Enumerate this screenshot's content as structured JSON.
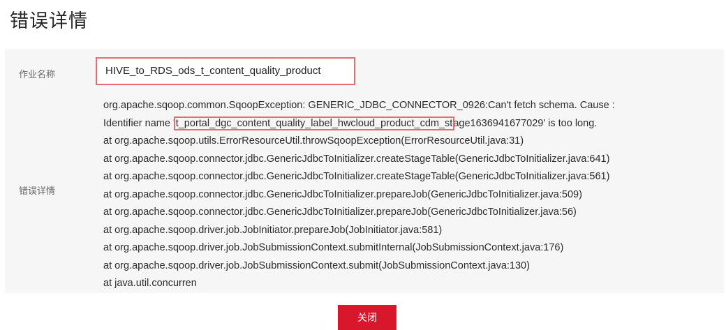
{
  "dialog": {
    "title": "错误详情",
    "close_label": "关闭"
  },
  "job": {
    "label": "作业名称",
    "name": "HIVE_to_RDS_ods_t_content_quality_product"
  },
  "error": {
    "label": "错误详情",
    "line1": "org.apache.sqoop.common.SqoopException: GENERIC_JDBC_CONNECTOR_0926:Can't fetch schema. Cause :",
    "line2_prefix": "Identifier name '",
    "line2_highlight": "t_portal_dgc_content_quality_label_hwcloud_product_cdm_st",
    "line2_suffix": "age1636941677029' is too long.",
    "stack": [
      "at org.apache.sqoop.utils.ErrorResourceUtil.throwSqoopException(ErrorResourceUtil.java:31)",
      "at org.apache.sqoop.connector.jdbc.GenericJdbcToInitializer.createStageTable(GenericJdbcToInitializer.java:641)",
      "at org.apache.sqoop.connector.jdbc.GenericJdbcToInitializer.createStageTable(GenericJdbcToInitializer.java:561)",
      "at org.apache.sqoop.connector.jdbc.GenericJdbcToInitializer.prepareJob(GenericJdbcToInitializer.java:509)",
      "at org.apache.sqoop.connector.jdbc.GenericJdbcToInitializer.prepareJob(GenericJdbcToInitializer.java:56)",
      "at org.apache.sqoop.driver.job.JobInitiator.prepareJob(JobInitiator.java:581)",
      "at org.apache.sqoop.driver.job.JobSubmissionContext.submitInternal(JobSubmissionContext.java:176)",
      "at org.apache.sqoop.driver.job.JobSubmissionContext.submit(JobSubmissionContext.java:130)",
      "at java.util.concurren"
    ]
  },
  "colors": {
    "highlight_border": "#e36d6d",
    "primary_button": "#d8182a",
    "panel_background": "#f6f6f6"
  }
}
